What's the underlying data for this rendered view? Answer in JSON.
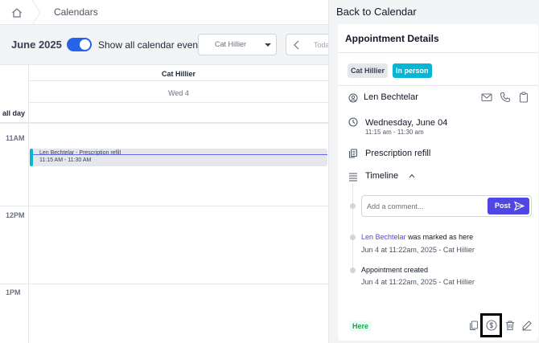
{
  "breadcrumb": {
    "section": "Calendars"
  },
  "toolbar": {
    "month_label": "June 2025",
    "show_all_label": "Show all calendar events",
    "show_all_enabled": true,
    "staff_select_value": "Cat Hillier",
    "today_label": "Today"
  },
  "calendar": {
    "column_header": "Cat Hillier",
    "day_header": "Wed 4",
    "all_day_label": "all day",
    "hours": [
      "11AM",
      "12PM",
      "1PM"
    ],
    "event": {
      "title": "Len Bechtelar - Prescription refill",
      "time": "11:15 AM - 11:30 AM",
      "color": "#06b6d4"
    }
  },
  "panel": {
    "back_label": "Back to Calendar",
    "title": "Appointment Details",
    "staff_chip": "Cat Hillier",
    "mode_chip": "In person",
    "patient_name": "Len Bechtelar",
    "date": "Wednesday, June 04",
    "time_range": "11:15 am - 11:30 am",
    "service": "Prescription refill",
    "timeline_label": "Timeline",
    "comment_placeholder": "Add a comment...",
    "post_label": "Post",
    "timeline": [
      {
        "actor": "Len Bechtelar",
        "text": "was marked as here",
        "meta": "Jun 4 at 11:22am, 2025 - Cat Hillier"
      },
      {
        "text": "Appointment created",
        "meta": "Jun 4 at 11:22am, 2025 - Cat Hillier"
      }
    ],
    "status_badge": "Here",
    "accent_color": "#4f46e5"
  }
}
